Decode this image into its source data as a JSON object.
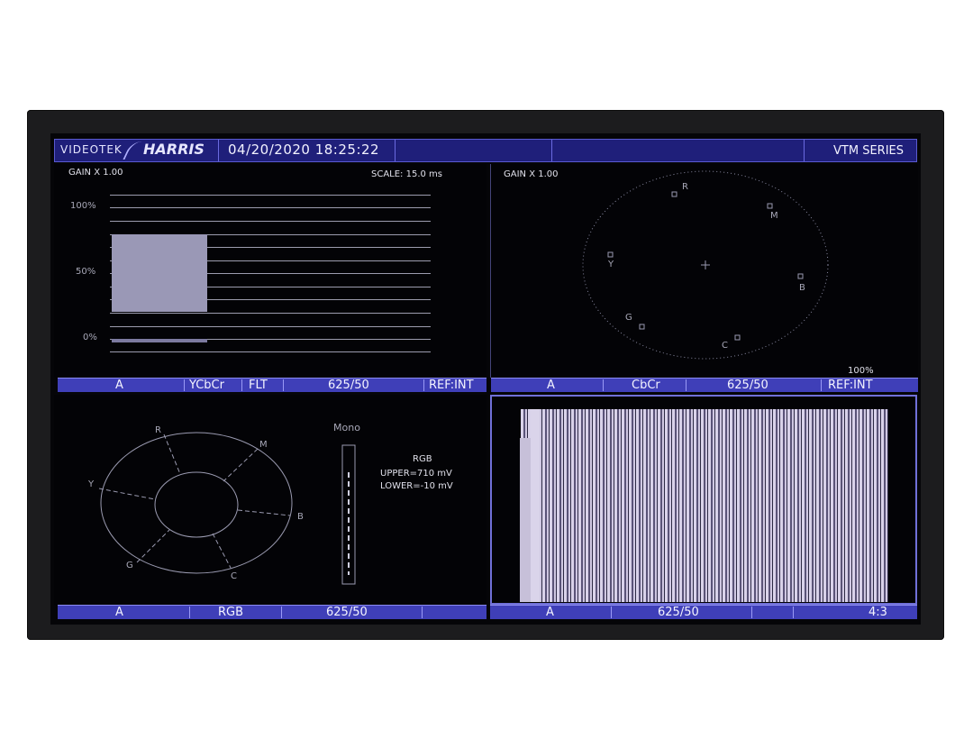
{
  "header": {
    "brand_left": "VIDEOTEK",
    "brand_right": "HARRIS",
    "datetime": "04/20/2020 18:25:22",
    "series": "VTM SERIES"
  },
  "waveform_panel": {
    "gain": "GAIN X 1.00",
    "scale": "SCALE: 15.0 ms",
    "ticks": [
      "100%",
      "50%",
      "0%"
    ],
    "status": [
      "A",
      "YCbCr",
      "FLT",
      "625/50",
      "REF:INT"
    ]
  },
  "vector_panel": {
    "gain": "GAIN X 1.00",
    "targets": [
      "R",
      "M",
      "Y",
      "B",
      "G",
      "C"
    ],
    "percent": "100%",
    "status": [
      "A",
      "CbCr",
      "625/50",
      "REF:INT"
    ]
  },
  "gamut_panel": {
    "mono": "Mono",
    "targets": [
      "R",
      "M",
      "Y",
      "B",
      "G",
      "C"
    ],
    "title": "RGB",
    "upper": "UPPER=710 mV",
    "lower": "LOWER=-10 mV",
    "status": [
      "A",
      "RGB",
      "625/50"
    ]
  },
  "picture_panel": {
    "status": [
      "A",
      "625/50",
      "4:3"
    ]
  },
  "colors": {
    "header_bg": "#1f1f7a",
    "status_bg": "#3f3fb8",
    "trace": "#9c9cae"
  }
}
